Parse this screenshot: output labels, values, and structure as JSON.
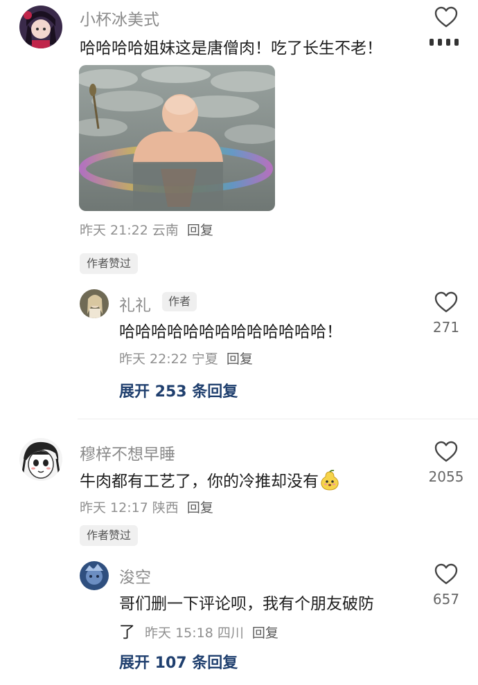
{
  "comments": [
    {
      "username": "小杯冰美式",
      "text": "哈哈哈哈姐妹这是唐僧肉！吃了长生不老！",
      "time": "昨天 21:22",
      "location": "云南",
      "reply_label": "回复",
      "badge": "作者赞过",
      "image_alt": "bald man sitting in pond water with lotus leaves",
      "replies": [
        {
          "username": "礼礼",
          "tag": "作者",
          "text": "哈哈哈哈哈哈哈哈哈哈哈哈哈！",
          "time": "昨天 22:22",
          "location": "宁夏",
          "reply_label": "回复",
          "likes": "271"
        }
      ],
      "expand_label": "展开 253 条回复"
    },
    {
      "username": "穆梓不想早睡",
      "text": "牛肉都有工艺了，你的冷推却没有",
      "emoji": "pear-face-emoji",
      "time": "昨天 12:17",
      "location": "陕西",
      "reply_label": "回复",
      "likes": "2055",
      "badge": "作者赞过",
      "replies": [
        {
          "username": "浚空",
          "text_line1": "哥们删一下评论呗，我有个朋友破防",
          "text_line2": "了",
          "time": "昨天 15:18",
          "location": "四川",
          "reply_label": "回复",
          "likes": "657"
        }
      ],
      "expand_label": "展开 107 条回复"
    }
  ],
  "colors": {
    "link": "#1f3f6e",
    "muted": "#8a8a8a",
    "text": "#1c1c1c"
  }
}
